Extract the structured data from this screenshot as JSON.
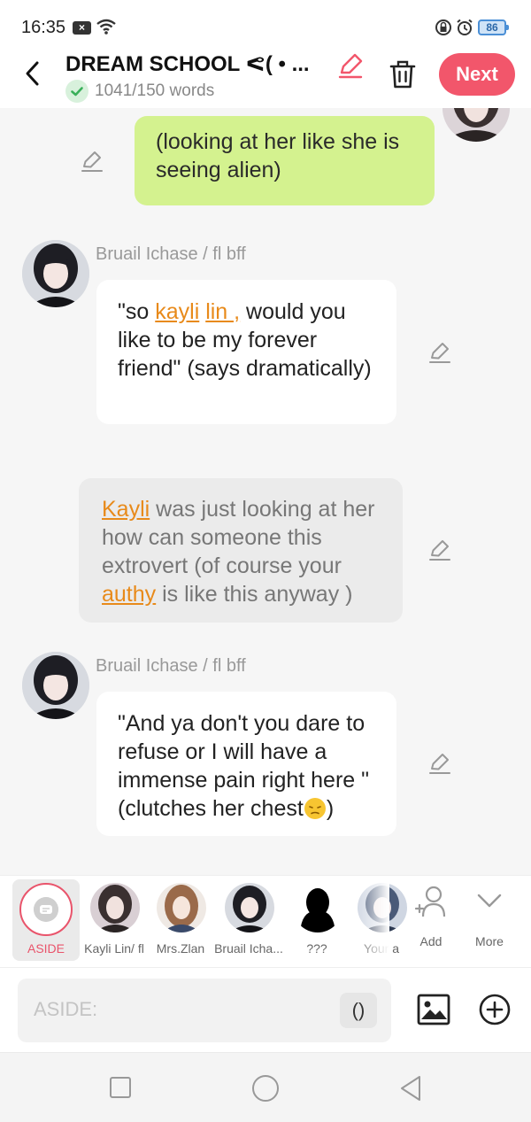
{
  "status": {
    "time": "16:35",
    "battery": "86"
  },
  "header": {
    "title": "DREAM SCHOOL ᕙ( • ...",
    "word_count": "1041/150 words",
    "next_label": "Next"
  },
  "messages": [
    {
      "type": "me",
      "text": "(looking at her like she is seeing alien)"
    },
    {
      "type": "character",
      "speaker": "Bruail Ichase / fl bff",
      "parts": [
        "\"so ",
        "kayli",
        " ",
        "lin ,",
        " would you like to be my forever friend\" (says dramatically)"
      ]
    },
    {
      "type": "aside",
      "parts": [
        "Kayli",
        " was just looking at her how can someone this extrovert (of course your ",
        "authy",
        " is like this anyway )"
      ]
    },
    {
      "type": "character",
      "speaker": "Bruail Ichase / fl bff",
      "text": "\"And ya don't you dare to refuse or I will have a immense pain right here \" (clutches her chest",
      "text_end": ")"
    }
  ],
  "characters": {
    "aside": "ASIDE",
    "list": [
      "Kayli Lin/ fl",
      "Mrs.Zlan",
      "Bruail Icha...",
      "???",
      "Your a"
    ],
    "add": "Add",
    "more": "More"
  },
  "input": {
    "placeholder": "ASIDE:",
    "paren": "()"
  },
  "colors": {
    "accent": "#f2566b",
    "my_bubble": "#d4f28f",
    "highlight": "#e88a1a"
  }
}
